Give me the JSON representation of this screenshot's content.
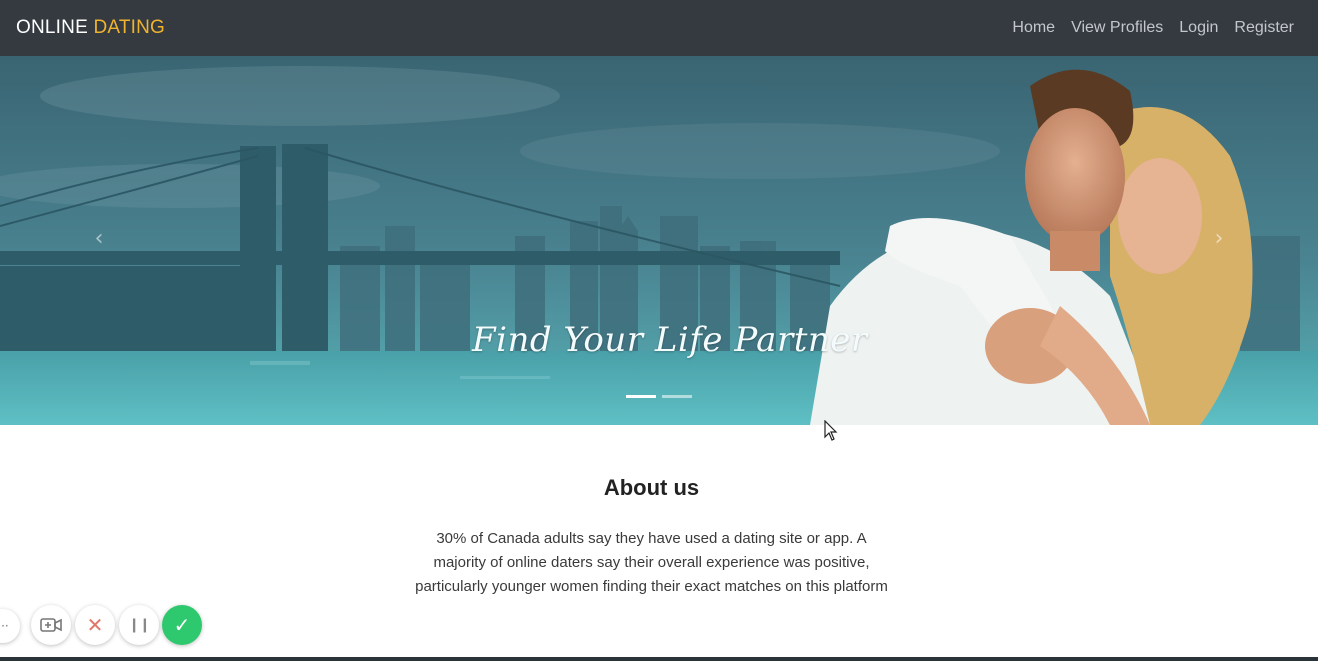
{
  "navbar": {
    "brand_primary": "ONLINE",
    "brand_accent": "DATING",
    "links": [
      "Home",
      "View Profiles",
      "Login",
      "Register"
    ]
  },
  "hero": {
    "caption": "Find Your Life Partner",
    "prev_icon": "chevron-left-icon",
    "next_icon": "chevron-right-icon",
    "prev_glyph": "‹",
    "next_glyph": "›",
    "slide_count": 2,
    "active_slide": 1
  },
  "about": {
    "title": "About us",
    "text": "30% of Canada adults say they have used a dating site or app. A majority of online daters say their overall experience was positive, particularly younger women finding their exact matches on this platform"
  },
  "recorder": {
    "more_glyph": "···",
    "camera_icon": "camera-icon",
    "close_glyph": "✕",
    "pause_glyph": "❙❙",
    "confirm_glyph": "✓"
  },
  "colors": {
    "navbar_bg": "#343a40",
    "brand_accent": "#f0b32e",
    "nav_link": "#c3c7cb",
    "confirm_green": "#2ec86e"
  }
}
